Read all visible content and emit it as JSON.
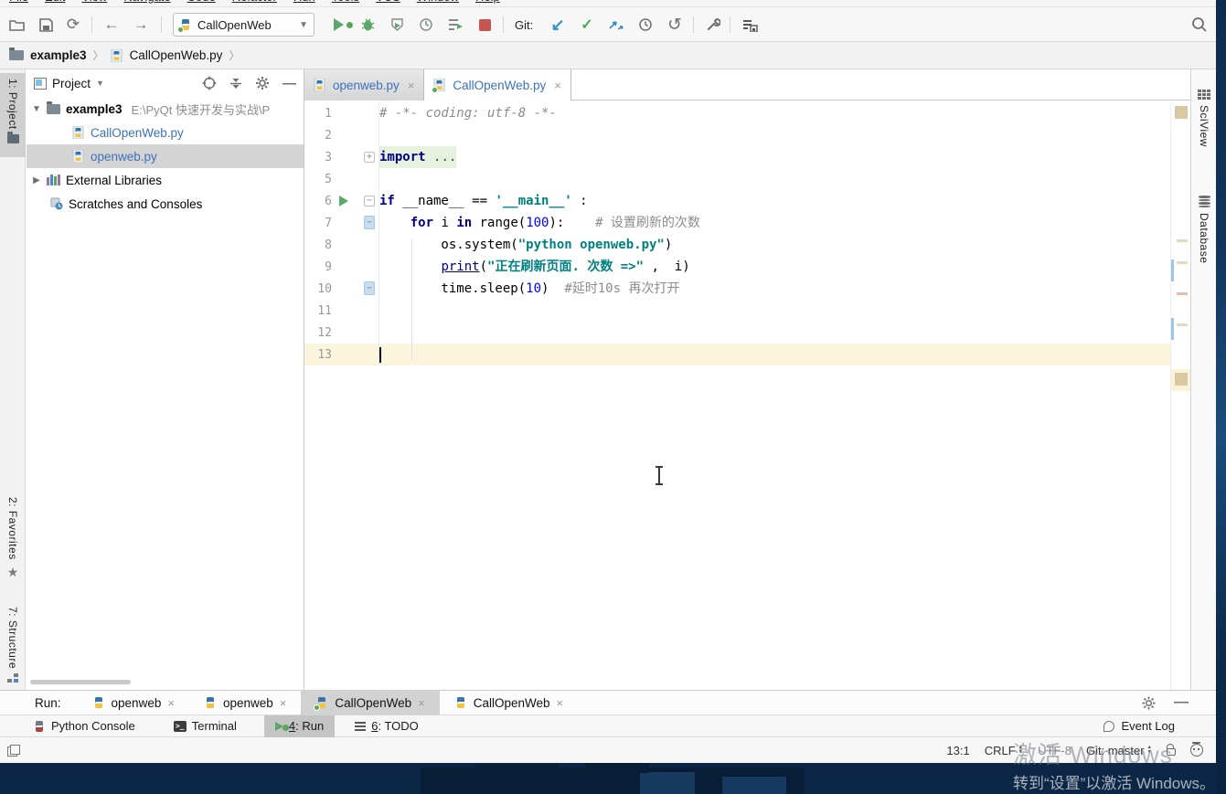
{
  "colors": {
    "accent_blue": "#3C72B8",
    "keyword_navy": "#000080",
    "string_teal": "#008080",
    "number_blue": "#0000FF",
    "comment_gray": "#8C8C8C",
    "run_green": "#59A869",
    "stop_red": "#C75450",
    "selection_gray": "#D4D4D4",
    "wallpaper_navy": "#0B2745"
  },
  "menu": {
    "items": [
      "File",
      "Edit",
      "View",
      "Navigate",
      "Code",
      "Refactor",
      "Run",
      "Tools",
      "VCS",
      "Window",
      "Help"
    ]
  },
  "toolbar": {
    "run_config": "CallOpenWeb",
    "git_label": "Git:"
  },
  "breadcrumb": {
    "folder": "example3",
    "file": "CallOpenWeb.py"
  },
  "left_stripe": {
    "project": "1: Project",
    "favorites": "2: Favorites",
    "structure": "7: Structure"
  },
  "project_panel": {
    "title": "Project",
    "root": "example3",
    "root_path": "E:\\PyQt 快速开发与实战\\P",
    "files": [
      {
        "name": "CallOpenWeb.py",
        "selected": false
      },
      {
        "name": "openweb.py",
        "selected": true
      }
    ],
    "external_libraries": "External Libraries",
    "scratches": "Scratches and Consoles"
  },
  "editor": {
    "tabs": [
      {
        "label": "openweb.py",
        "active": false
      },
      {
        "label": "CallOpenWeb.py",
        "active": true
      }
    ],
    "lines": [
      {
        "n": "1",
        "tokens": [
          [
            "comi",
            "# -*- coding: utf-8 -*-"
          ]
        ]
      },
      {
        "n": "2",
        "tokens": []
      },
      {
        "n": "3",
        "fold": "plus",
        "hl": "green",
        "tokens": [
          [
            "kw",
            "import"
          ],
          [
            "pl",
            " "
          ],
          [
            "fold",
            "..."
          ]
        ]
      },
      {
        "n": "5",
        "tokens": []
      },
      {
        "n": "6",
        "run": true,
        "fold": "minus",
        "tokens": [
          [
            "kw",
            "if"
          ],
          [
            "pl",
            " __name__ == "
          ],
          [
            "str",
            "'__main__'"
          ],
          [
            "pl",
            " :"
          ]
        ]
      },
      {
        "n": "7",
        "fold": "minusblue",
        "tokens": [
          [
            "pl",
            "    "
          ],
          [
            "kw",
            "for"
          ],
          [
            "pl",
            " i "
          ],
          [
            "kw",
            "in"
          ],
          [
            "pl",
            " range("
          ],
          [
            "num",
            "100"
          ],
          [
            "pl",
            "):    "
          ],
          [
            "com",
            "# 设置刷新的次数"
          ]
        ]
      },
      {
        "n": "8",
        "tokens": [
          [
            "pl",
            "        os.system("
          ],
          [
            "str",
            "\"python openweb.py\""
          ],
          [
            "pl",
            ")"
          ]
        ]
      },
      {
        "n": "9",
        "tokens": [
          [
            "pl",
            "        "
          ],
          [
            "bi",
            "print"
          ],
          [
            "pl",
            "("
          ],
          [
            "str",
            "\"正在刷新页面. 次数 =>\""
          ],
          [
            "pl",
            " ,  i)"
          ]
        ]
      },
      {
        "n": "10",
        "fold": "minusblue",
        "tokens": [
          [
            "pl",
            "        time.sleep("
          ],
          [
            "num",
            "10"
          ],
          [
            "pl",
            ")  "
          ],
          [
            "com",
            "#延时10s 再次打开"
          ]
        ]
      },
      {
        "n": "11",
        "tokens": []
      },
      {
        "n": "12",
        "tokens": []
      },
      {
        "n": "13",
        "caret": true,
        "tokens": []
      }
    ]
  },
  "right_stripe": {
    "sciview": "SciView",
    "database": "Database"
  },
  "run_panel": {
    "label": "Run:",
    "tabs": [
      {
        "label": "openweb",
        "selected": false
      },
      {
        "label": "openweb",
        "selected": false
      },
      {
        "label": "CallOpenWeb",
        "selected": true
      },
      {
        "label": "CallOpenWeb",
        "selected": false
      }
    ]
  },
  "tool_windows": {
    "python_console": "Python Console",
    "terminal": "Terminal",
    "run_num": "4",
    "run_text": ": Run",
    "todo_num": "6",
    "todo_text": ": TODO",
    "event_log": "Event Log"
  },
  "status_bar": {
    "caret_position": "13:1",
    "line_separator": "CRLF",
    "encoding": "UTF-8",
    "git_branch": "Git: master"
  },
  "watermark": {
    "line1": "激活 Windows",
    "line2": "转到“设置”以激活 Windows。"
  }
}
